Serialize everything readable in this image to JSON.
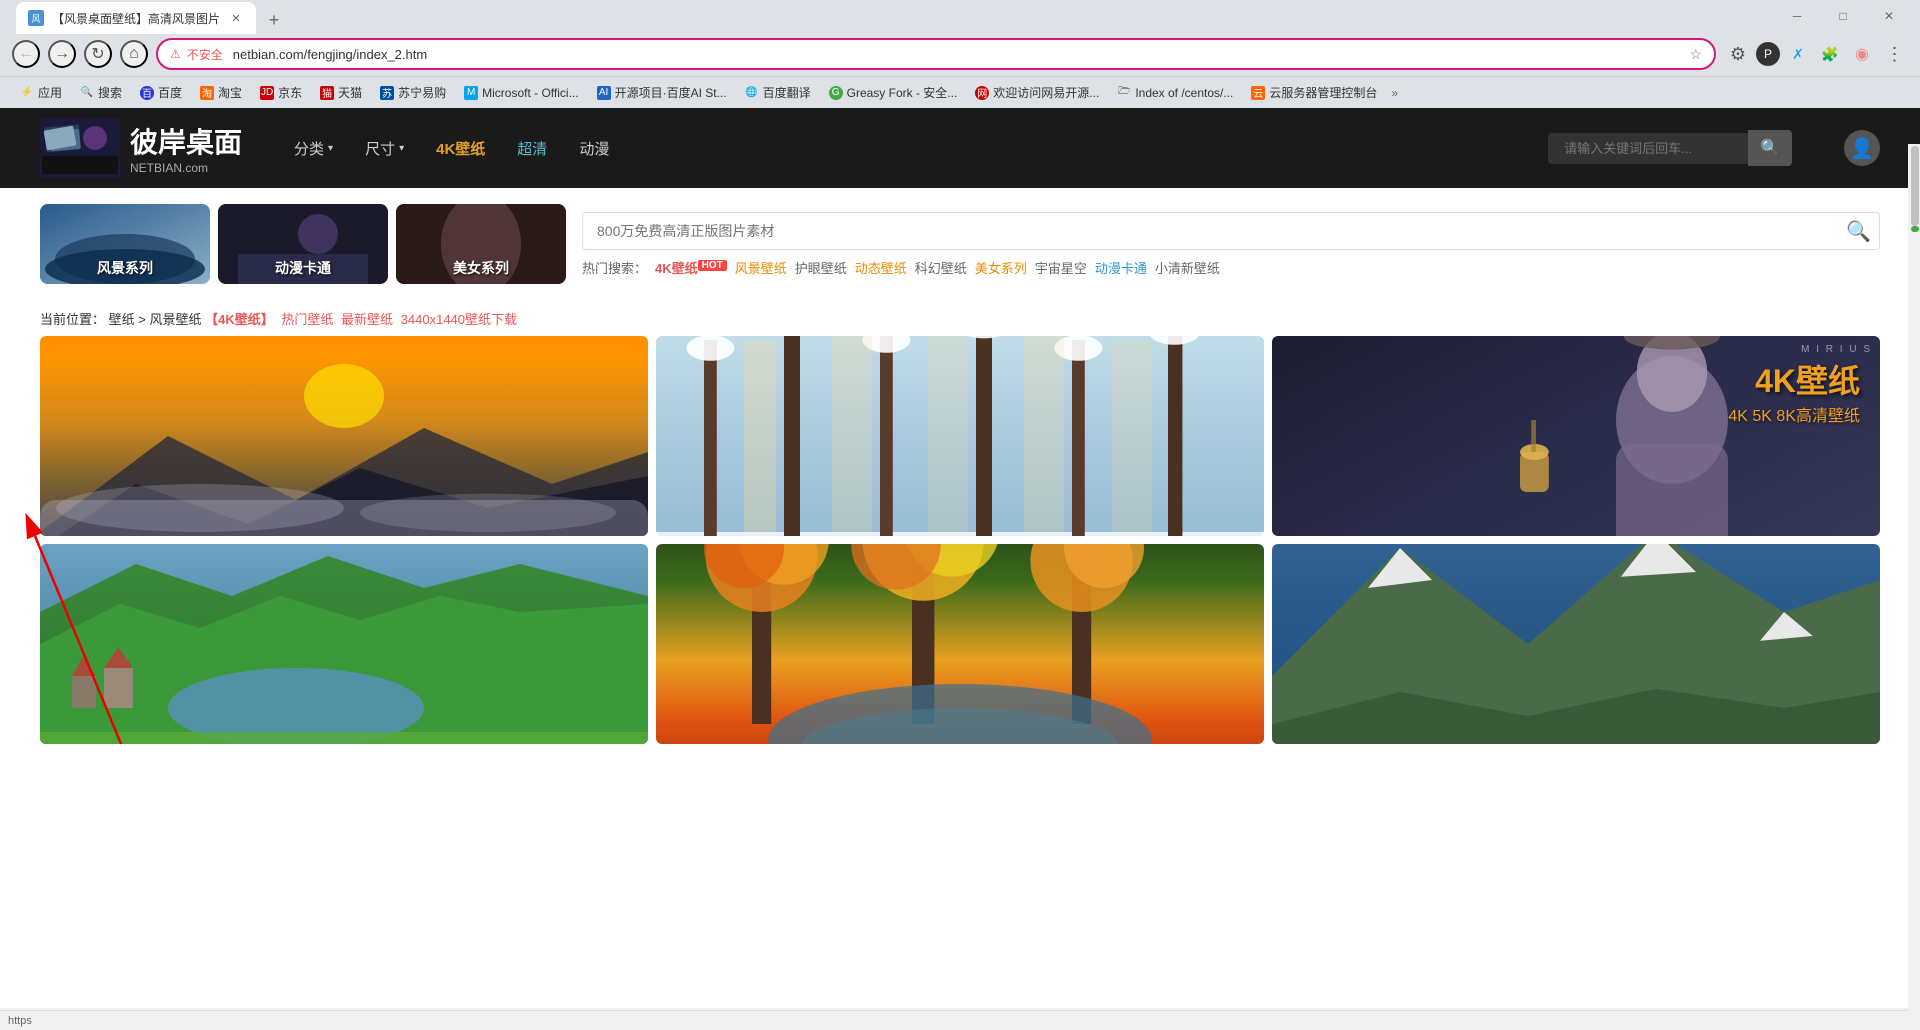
{
  "browser": {
    "tab": {
      "title": "【风景桌面壁纸】高清风景图片",
      "favicon_label": "风"
    },
    "address_bar": {
      "url": "netbian.com/fengjing/index_2.htm",
      "security_label": "不安全",
      "lock_icon": "⚠"
    },
    "bookmarks": [
      {
        "label": "应用",
        "icon": "⚡"
      },
      {
        "label": "搜索",
        "icon": "🔍"
      },
      {
        "label": "百度",
        "icon": "🅱"
      },
      {
        "label": "淘宝",
        "icon": "◈"
      },
      {
        "label": "京东",
        "icon": "J"
      },
      {
        "label": "天猫",
        "icon": "♦"
      },
      {
        "label": "苏宁易购",
        "icon": "S"
      },
      {
        "label": "Microsoft - Offici...",
        "icon": "M"
      },
      {
        "label": "开源项目·百度AI St...",
        "icon": "AI"
      },
      {
        "label": "百度翻译",
        "icon": "🌐"
      },
      {
        "label": "Greasy Fork - 安全...",
        "icon": "🔧"
      },
      {
        "label": "欢迎访问网易开源...",
        "icon": "☯"
      },
      {
        "label": "Index of /centos/...",
        "icon": "🗁"
      },
      {
        "label": "云服务器管理控制台",
        "icon": "☁"
      }
    ],
    "window_controls": {
      "minimize": "─",
      "maximize": "□",
      "close": "✕"
    }
  },
  "website": {
    "logo": {
      "title": "彼岸桌面",
      "subtitle": "NETBIAN.com"
    },
    "nav": [
      {
        "label": "分类",
        "has_dropdown": true
      },
      {
        "label": "尺寸",
        "has_dropdown": true
      },
      {
        "label": "4K壁纸",
        "highlight": "orange"
      },
      {
        "label": "超清",
        "highlight": "cyan"
      },
      {
        "label": "动漫",
        "highlight": "none"
      }
    ],
    "search_placeholder": "请输入关键词后回车...",
    "user_icon": "👤",
    "categories": [
      {
        "label": "风景系列",
        "type": "landscape"
      },
      {
        "label": "动漫卡通",
        "type": "anime"
      },
      {
        "label": "美女系列",
        "type": "beauty"
      }
    ],
    "big_search_placeholder": "800万免费高清正版图片素材",
    "hot_search_label": "热门搜索：",
    "hot_tags": [
      {
        "label": "4K壁纸",
        "color": "red",
        "badge": "HOT"
      },
      {
        "label": "风景壁纸",
        "color": "orange"
      },
      {
        "label": "护眼壁纸",
        "color": "normal"
      },
      {
        "label": "动态壁纸",
        "color": "orange"
      },
      {
        "label": "科幻壁纸",
        "color": "normal"
      },
      {
        "label": "美女系列",
        "color": "orange"
      },
      {
        "label": "宇宙星空",
        "color": "normal"
      },
      {
        "label": "动漫卡通",
        "color": "blue"
      },
      {
        "label": "小清新壁纸",
        "color": "normal"
      }
    ],
    "breadcrumb": {
      "prefix": "当前位置：",
      "path": "壁纸 > 风景壁纸",
      "link_4k": "【4K壁纸】",
      "links": [
        {
          "label": "热门壁纸",
          "color": "red"
        },
        {
          "label": "最新壁纸",
          "color": "red"
        },
        {
          "label": "3440x1440壁纸下载",
          "color": "red"
        }
      ]
    },
    "grid_images": [
      {
        "type": "sunset",
        "alt": "日落山景"
      },
      {
        "type": "forest_snow",
        "alt": "雪中森林"
      },
      {
        "type": "anime_4k",
        "alt": "4K壁纸动漫",
        "overlay1": "4K壁纸",
        "overlay2": "4K 5K 8K高清壁纸"
      },
      {
        "type": "valley",
        "alt": "田园山谷"
      },
      {
        "type": "autumn",
        "alt": "秋色林景"
      },
      {
        "type": "mountain",
        "alt": "雪山风光"
      }
    ],
    "anime_label1": "4K壁纸",
    "anime_label2": "4K 5K 8K高清壁纸",
    "status_bar_url": "https"
  },
  "annotation": {
    "arrow_visible": true
  }
}
